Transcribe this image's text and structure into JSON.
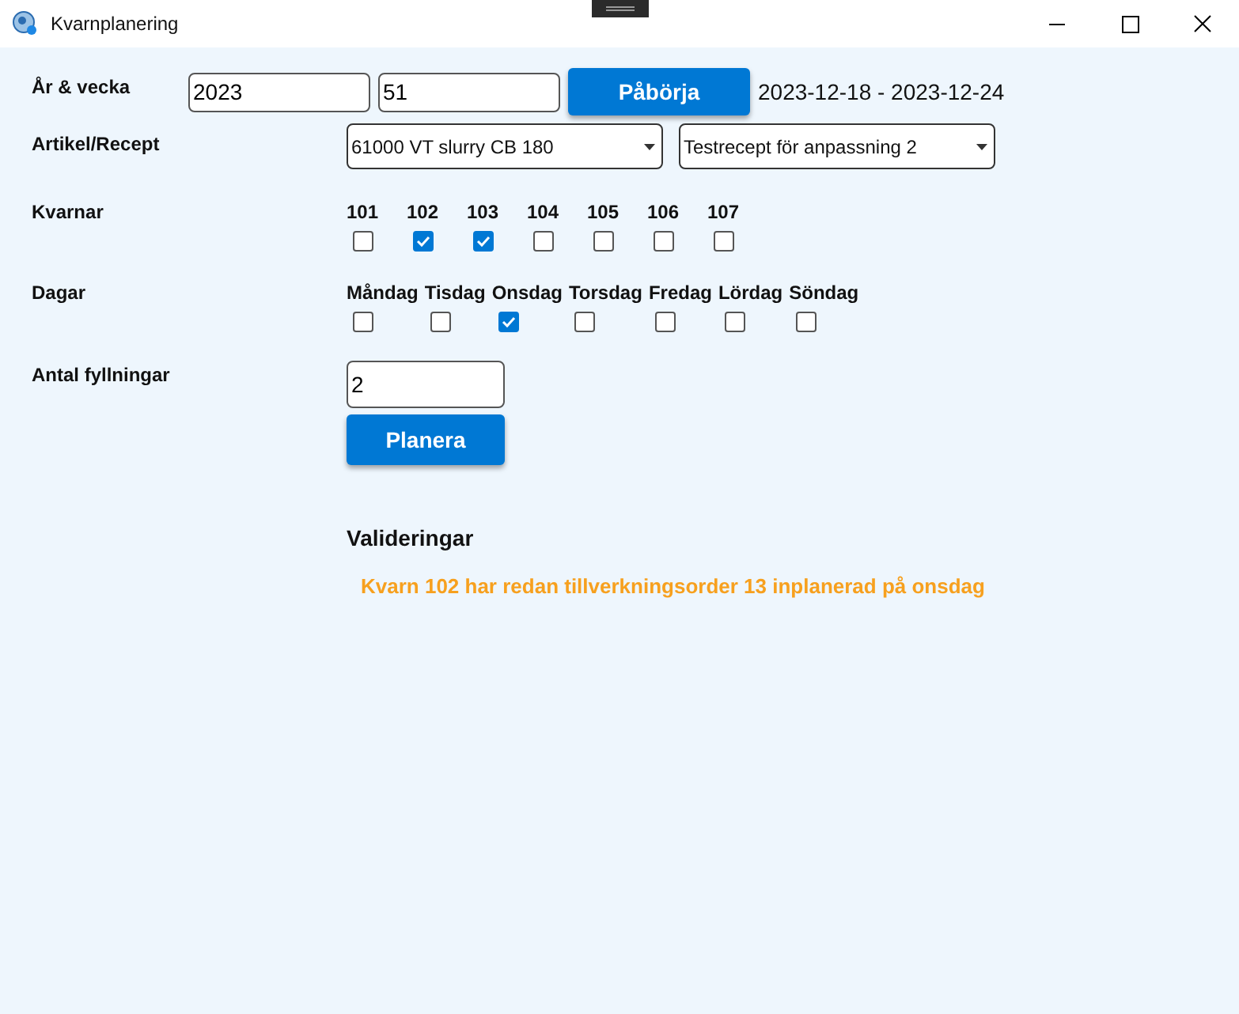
{
  "window": {
    "title": "Kvarnplanering"
  },
  "year_week": {
    "label": "År & vecka",
    "year": "2023",
    "week": "51",
    "button": "Påbörja",
    "date_range": "2023-12-18 - 2023-12-24"
  },
  "article_recipe": {
    "label": "Artikel/Recept",
    "article": "61000 VT slurry CB 180",
    "recipe": "Testrecept för anpassning 2"
  },
  "mills": {
    "label": "Kvarnar",
    "items": [
      {
        "label": "101",
        "checked": false
      },
      {
        "label": "102",
        "checked": true
      },
      {
        "label": "103",
        "checked": true
      },
      {
        "label": "104",
        "checked": false
      },
      {
        "label": "105",
        "checked": false
      },
      {
        "label": "106",
        "checked": false
      },
      {
        "label": "107",
        "checked": false
      }
    ]
  },
  "days": {
    "label": "Dagar",
    "items": [
      {
        "label": "Måndag",
        "checked": false
      },
      {
        "label": "Tisdag",
        "checked": false
      },
      {
        "label": "Onsdag",
        "checked": true
      },
      {
        "label": "Torsdag",
        "checked": false
      },
      {
        "label": "Fredag",
        "checked": false
      },
      {
        "label": "Lördag",
        "checked": false
      },
      {
        "label": "Söndag",
        "checked": false
      }
    ]
  },
  "fillings": {
    "label": "Antal fyllningar",
    "value": "2",
    "button": "Planera"
  },
  "validations": {
    "title": "Valideringar",
    "messages": [
      "Kvarn 102 har redan tillverkningsorder 13 inplanerad på onsdag"
    ]
  }
}
